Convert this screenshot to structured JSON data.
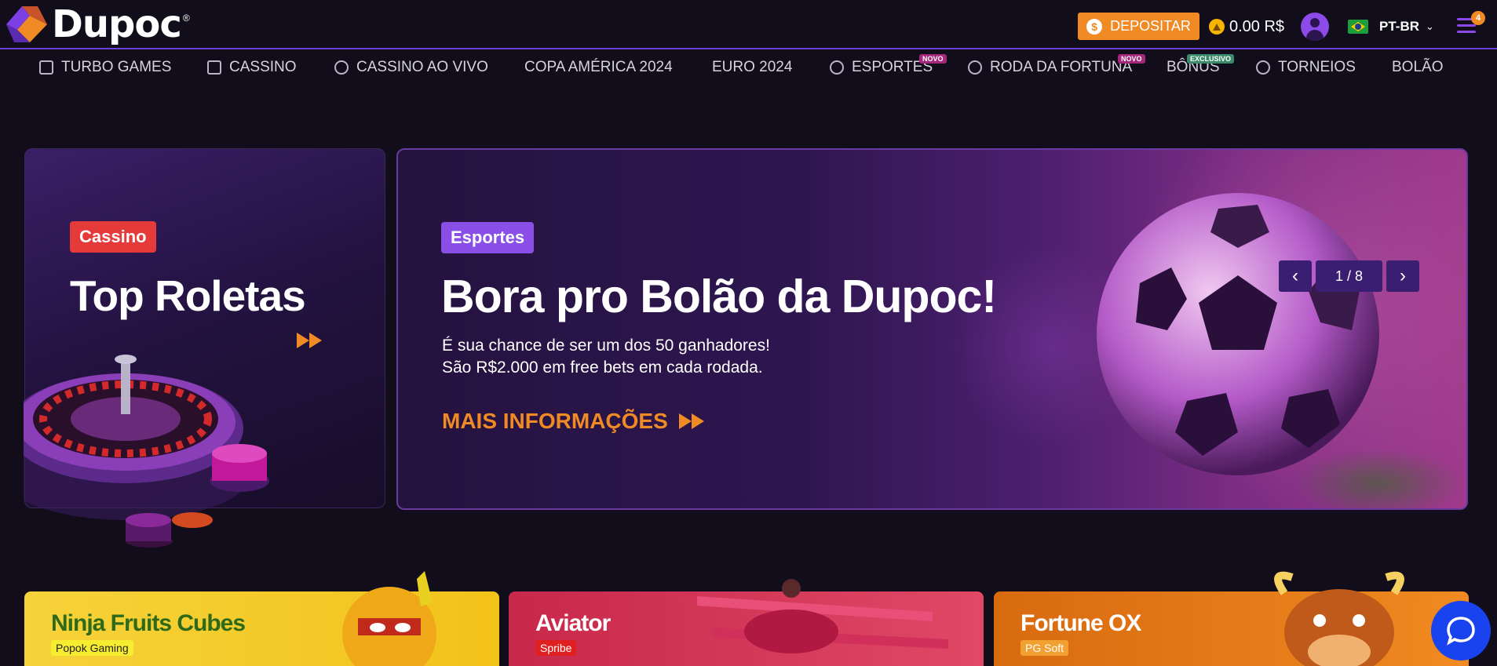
{
  "header": {
    "logo_text": "Dupoc",
    "logo_reg": "®",
    "deposit_label": "DEPOSITAR",
    "balance": "0.00 R$",
    "language": "PT-BR",
    "menu_badge": "4"
  },
  "nav": {
    "items": [
      {
        "label": "TURBO GAMES"
      },
      {
        "label": "CASSINO"
      },
      {
        "label": "CASSINO AO VIVO"
      },
      {
        "label": "COPA AMÉRICA 2024"
      },
      {
        "label": "EURO 2024"
      },
      {
        "label": "ESPORTES",
        "tag": "NOVO"
      },
      {
        "label": "RODA DA FORTUNA",
        "tag": "NOVO"
      },
      {
        "label": "BÔNUS",
        "tag": "EXCLUSIVO"
      },
      {
        "label": "TORNEIOS"
      },
      {
        "label": "BOLÃO"
      }
    ]
  },
  "banner_left": {
    "category": "Cassino",
    "title": "Top Roletas"
  },
  "banner_main": {
    "category": "Esportes",
    "title": "Bora pro Bolão da Dupoc!",
    "line1": "É sua chance de ser um dos 50 ganhadores!",
    "line2": "São R$2.000 em free bets em cada rodada.",
    "cta": "MAIS INFORMAÇÕES",
    "slide_counter": "1 / 8"
  },
  "games": [
    {
      "title": "Ninja Fruits Cubes",
      "provider": "Popok Gaming"
    },
    {
      "title": "Aviator",
      "provider": "Spribe"
    },
    {
      "title": "Fortune OX",
      "provider": "PG Soft"
    }
  ],
  "colors": {
    "background": "#110d1a",
    "accent_orange": "#f08a25",
    "accent_purple": "#8c4ae8",
    "cassino_red": "#e43a3a",
    "chat_blue": "#1a43f0"
  }
}
